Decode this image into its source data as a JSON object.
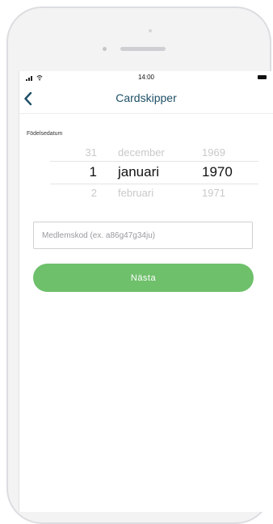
{
  "status_bar": {
    "time": "14:00"
  },
  "nav": {
    "title": "Cardskipper",
    "back_icon": "chevron-left-icon"
  },
  "birthdate": {
    "label": "Födelsedatum",
    "rows": [
      {
        "day": "31",
        "month": "december",
        "year": "1969"
      },
      {
        "day": "1",
        "month": "januari",
        "year": "1970"
      },
      {
        "day": "2",
        "month": "februari",
        "year": "1971"
      }
    ],
    "selected_index": 1
  },
  "member_code": {
    "value": "",
    "placeholder": "Medlemskod (ex. a86g47g34ju)"
  },
  "next_button": {
    "label": "Nästa"
  },
  "colors": {
    "title": "#1e4f66",
    "button": "#6ec06b",
    "button_text": "#ffffff",
    "picker_inactive": "#c9c9cc"
  }
}
